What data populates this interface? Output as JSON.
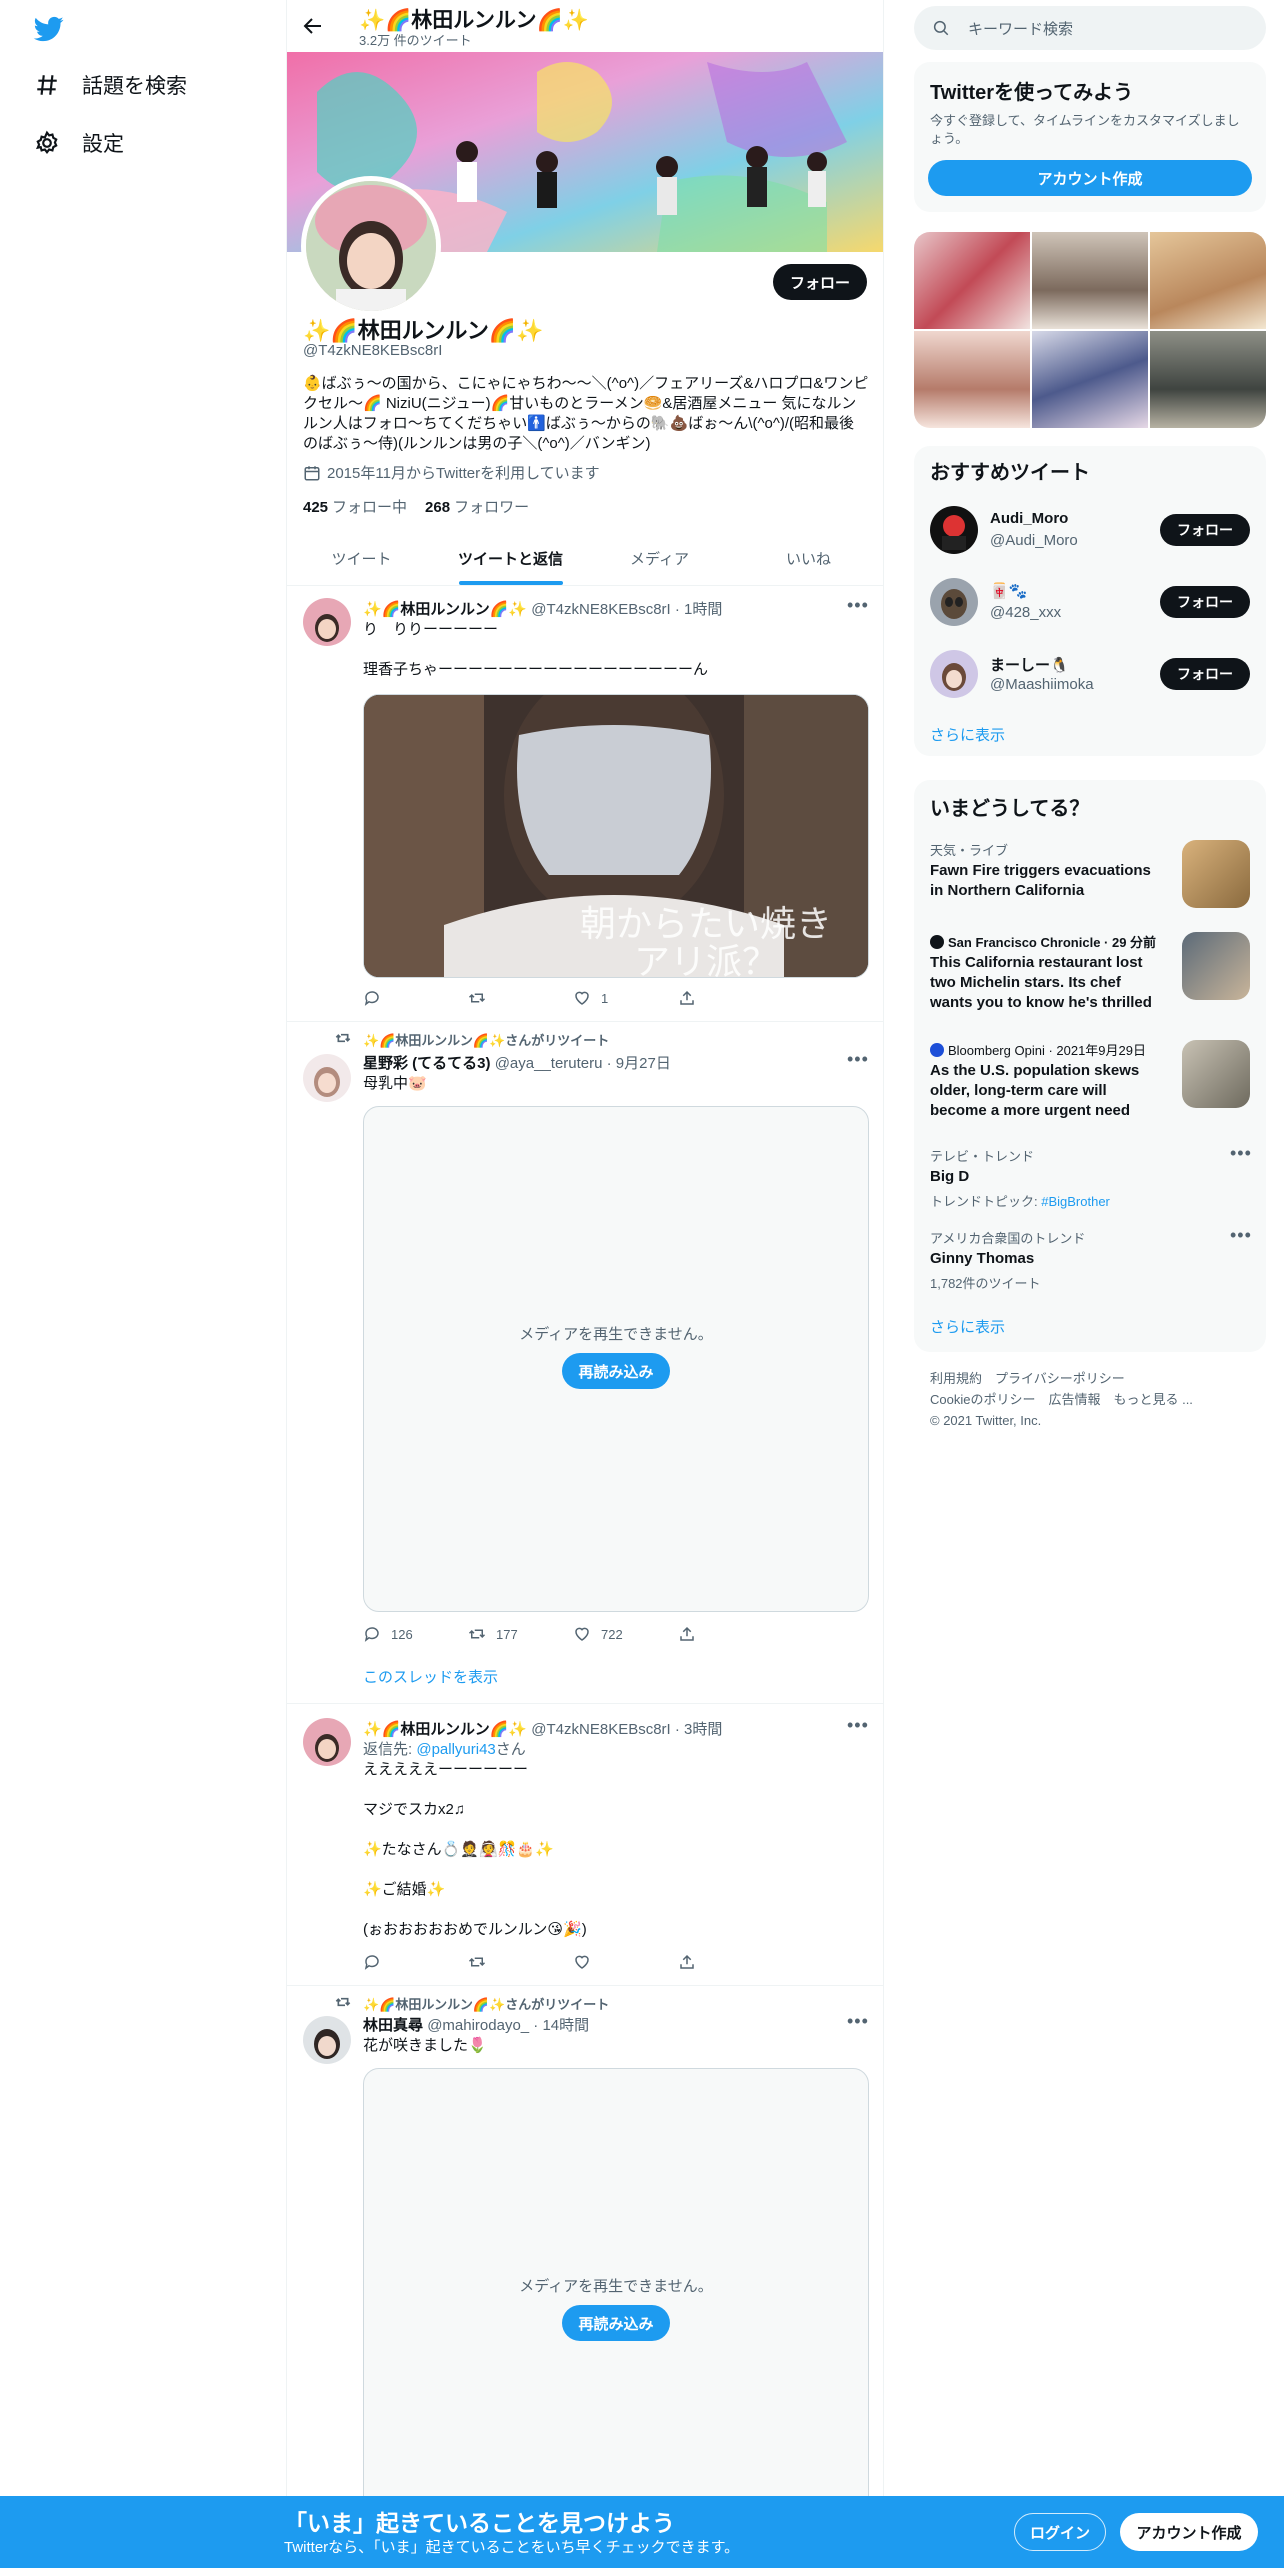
{
  "nav": {
    "explore_label": "話題を検索",
    "settings_label": "設定"
  },
  "header": {
    "title": "✨🌈林田ルンルン🌈✨",
    "tweet_count": "3.2万 件のツイート"
  },
  "profile": {
    "name": "✨🌈林田ルンルン🌈✨",
    "handle": "@T4zkNE8KEBsc8rI",
    "follow_label": "フォロー",
    "bio": "👶ばぶぅ〜の国から、こにゃにゃちわ〜〜＼(^o^)／フェアリーズ&ハロプロ&ワンピクセル〜🌈 NiziU(ニジュー)🌈甘いものとラーメン🥯&居酒屋メニュー 気になルンルン人はフォロ〜ちてくだちゃい🚹ばぶぅ〜からの🐘💩ばぉ〜ん\\(^o^)/(昭和最後のばぶぅ〜侍)(ルンルンは男の子＼(^o^)／バンギン)",
    "joined": "2015年11月からTwitterを利用しています",
    "following_count": "425",
    "following_label": "フォロー中",
    "followers_count": "268",
    "followers_label": "フォロワー"
  },
  "tabs": [
    "ツイート",
    "ツイートと返信",
    "メディア",
    "いいね"
  ],
  "tweets": [
    {
      "name": "✨🌈林田ルンルン🌈✨",
      "handle": "@T4zkNE8KEBsc8rI · 1時間",
      "text": "り　りりーーーーー\n\n理香子ちゃーーーーーーーーーーーーーーーーーん",
      "caption": "朝からたい焼き\nアリ派？",
      "likes": "1"
    },
    {
      "retweeted_by": "✨🌈林田ルンルン🌈✨さんがリツイート",
      "name": "星野彩 (てるてる3)",
      "handle": "@aya__teruteru · 9月27日",
      "text": "母乳中🐷",
      "media_msg": "メディアを再生できません。",
      "reload_label": "再読み込み",
      "replies": "126",
      "retweets": "177",
      "likes": "722",
      "thread_link": "このスレッドを表示"
    },
    {
      "name": "✨🌈林田ルンルン🌈✨",
      "handle": "@T4zkNE8KEBsc8rI · 3時間",
      "reply_to_prefix": "返信先: ",
      "reply_to_handle": "@pallyuri43",
      "reply_to_suffix": "さん",
      "text": "えええええーーーーーー\n\nマジでスカx2♫\n\n✨たなさん💍🤵👰🎊🎂✨\n\n✨ご結婚✨\n\n(ぉおおおおおめでルンルン😘🎉)"
    },
    {
      "retweeted_by": "✨🌈林田ルンルン🌈✨さんがリツイート",
      "name": "林田真尋",
      "handle": "@mahirodayo_ · 14時間",
      "text": "花が咲きました🌷",
      "media_msg": "メディアを再生できません。",
      "reload_label": "再読み込み"
    }
  ],
  "search": {
    "placeholder": "キーワード検索"
  },
  "signup_panel": {
    "title": "Twitterを使ってみよう",
    "desc": "今すぐ登録して、タイムラインをカスタマイズしましょう。",
    "button": "アカウント作成"
  },
  "who_to_follow": {
    "title": "おすすめツイート",
    "users": [
      {
        "name": "Audi_Moro",
        "handle": "@Audi_Moro",
        "button": "フォロー"
      },
      {
        "name": "🀄🐾",
        "handle": "@428_xxx",
        "button": "フォロー"
      },
      {
        "name": "まーしー🐧",
        "handle": "@Maashiimoka",
        "button": "フォロー"
      }
    ],
    "show_more": "さらに表示"
  },
  "trends": {
    "title": "いまどうしてる？",
    "items": [
      {
        "meta": "天気・ライブ",
        "title": "Fawn Fire triggers evacuations in Northern California"
      },
      {
        "meta": "San Francisco Chronicle · 29 分前",
        "title": "This California restaurant lost two Michelin stars. Its chef wants you to know he's thrilled"
      },
      {
        "meta": "Bloomberg Opini · 2021年9月29日",
        "title": "As the U.S. population skews older, long-term care will become a more urgent need"
      },
      {
        "meta": "テレビ・トレンド",
        "title": "Big D",
        "extra_prefix": "トレンドトピック: ",
        "extra_link": "#BigBrother"
      },
      {
        "meta": "アメリカ合衆国のトレンド",
        "title": "Ginny Thomas",
        "extra_count": "1,782件のツイート"
      }
    ],
    "show_more": "さらに表示"
  },
  "footer": {
    "line1": "利用規約　プライバシーポリシー",
    "line2": "Cookieのポリシー　広告情報　もっと見る ...",
    "line3": "© 2021 Twitter, Inc."
  },
  "bottom_bar": {
    "title": "「いま」起きていることを見つけよう",
    "subtitle": "Twitterなら、「いま」起きていることをいち早くチェックできます。",
    "login": "ログイン",
    "signup": "アカウント作成"
  },
  "colors": {
    "accent": "#1d9bf0",
    "dark": "#0f1419",
    "muted": "#536471"
  }
}
